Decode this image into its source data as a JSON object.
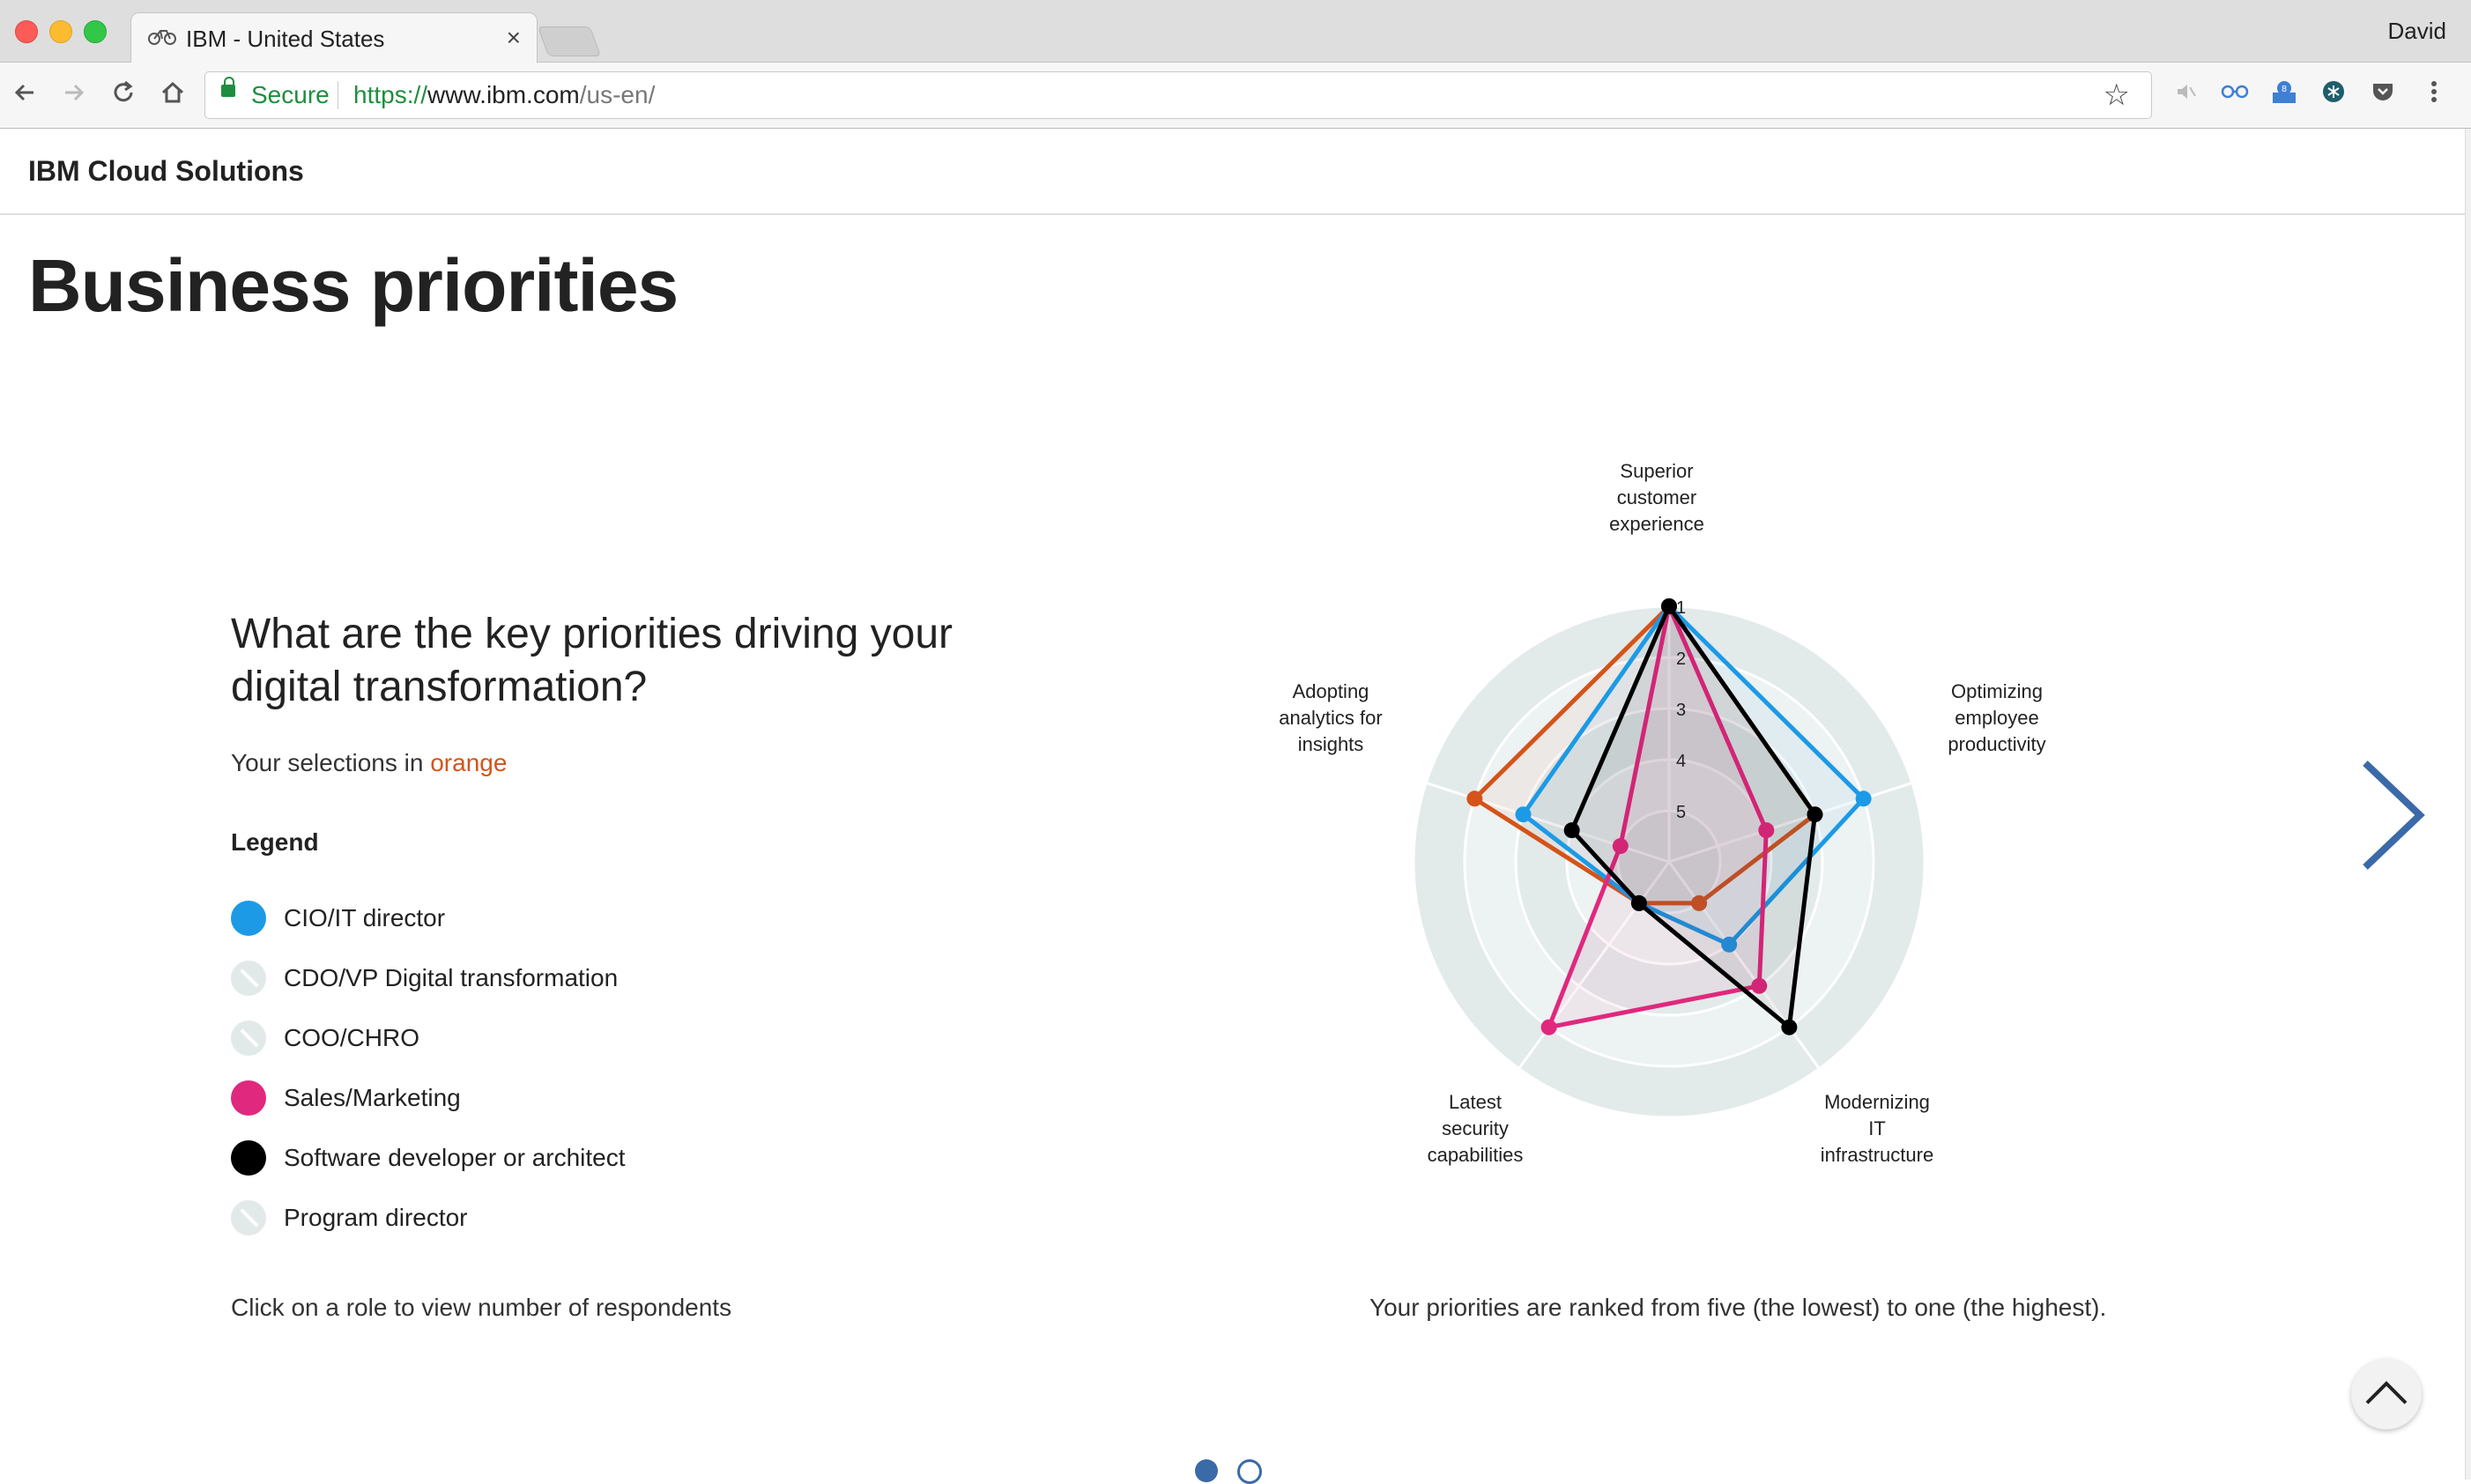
{
  "browser": {
    "tab_title": "IBM - United States",
    "tab_close": "×",
    "profile_name": "David",
    "secure_label": "Secure",
    "url_scheme": "https://",
    "url_host": "www.ibm.com",
    "url_path": "/us-en/"
  },
  "site": {
    "name": "IBM Cloud Solutions"
  },
  "page": {
    "title": "Business priorities",
    "question": "What are the key priorities driving your digital transformation?",
    "selections_prefix": "Your selections in ",
    "selections_color_word": "orange",
    "legend_title": "Legend",
    "legend": [
      {
        "label": "CIO/IT director",
        "active": true,
        "color": "#1c9ae6"
      },
      {
        "label": "CDO/VP Digital transformation",
        "active": false,
        "color": "#e2e9e9"
      },
      {
        "label": "COO/CHRO",
        "active": false,
        "color": "#e2e9e9"
      },
      {
        "label": "Sales/Marketing",
        "active": true,
        "color": "#e0287e"
      },
      {
        "label": "Software developer or architect",
        "active": true,
        "color": "#000000"
      },
      {
        "label": "Program director",
        "active": false,
        "color": "#e2e9e9"
      }
    ],
    "click_note": "Click on a role to view number of respondents",
    "rank_note": "Your priorities are ranked from five (the lowest) to one (the highest)."
  },
  "chart_data": {
    "type": "radar",
    "axes": [
      "Superior customer experience",
      "Optimizing employee productivity",
      "Modernizing IT infrastructure",
      "Latest security capabilities",
      "Adopting analytics for insights"
    ],
    "axis_label_lines": [
      [
        "Superior",
        "customer",
        "experience"
      ],
      [
        "Optimizing",
        "employee",
        "productivity"
      ],
      [
        "Modernizing",
        "IT",
        "infrastructure"
      ],
      [
        "Latest",
        "security",
        "capabilities"
      ],
      [
        "Adopting",
        "analytics for",
        "insights"
      ]
    ],
    "rank_ticks": [
      "1",
      "2",
      "3",
      "4",
      "5"
    ],
    "scale": "rank, 1 = highest (outer) to 5 = lowest (inner)",
    "series": [
      {
        "name": "Your selections",
        "color": "#d4541a",
        "values": [
          1,
          3,
          5,
          5,
          2
        ]
      },
      {
        "name": "CIO/IT director",
        "color": "#1c9ae6",
        "values": [
          1,
          2,
          4,
          5,
          3
        ]
      },
      {
        "name": "Sales/Marketing",
        "color": "#e0287e",
        "values": [
          1,
          4,
          3,
          2,
          5
        ]
      },
      {
        "name": "Software developer or architect",
        "color": "#000000",
        "values": [
          1,
          3,
          2,
          5,
          4
        ]
      }
    ]
  },
  "pagination": {
    "current": 1,
    "total": 2
  },
  "colors": {
    "accent_blue": "#3b6aa8",
    "orange": "#d4541a"
  }
}
